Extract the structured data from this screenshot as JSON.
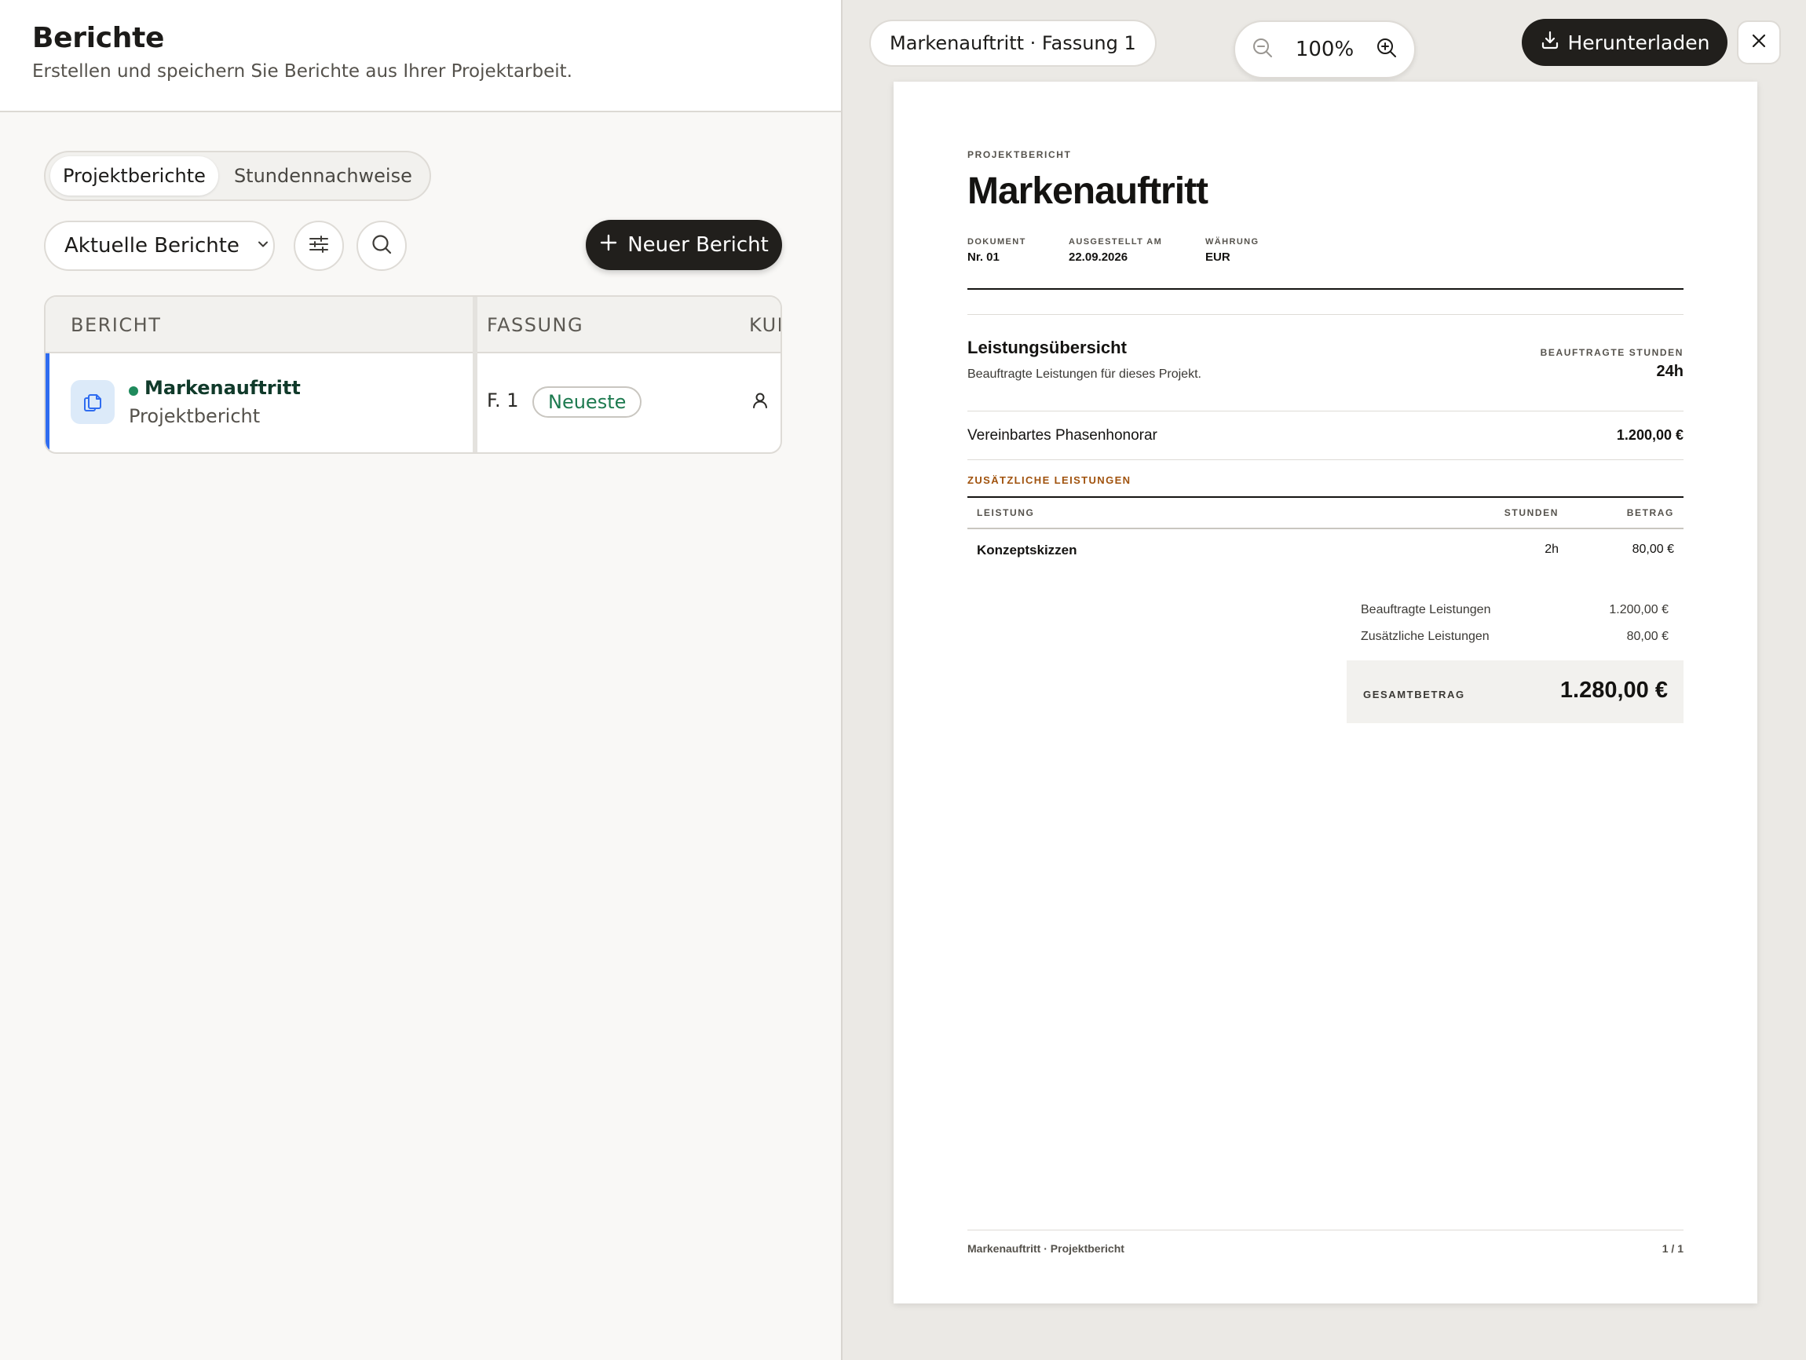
{
  "header": {
    "title": "Berichte",
    "subtitle": "Erstellen und speichern Sie Berichte aus Ihrer Projektarbeit."
  },
  "tabs": [
    {
      "label": "Projektberichte",
      "active": true
    },
    {
      "label": "Stundennachweise",
      "active": false
    }
  ],
  "toolbar": {
    "filter_value": "Aktuelle Berichte",
    "new_report_label": "Neuer Bericht"
  },
  "table": {
    "columns": [
      "BERICHT",
      "FASSUNG",
      "KUN"
    ],
    "rows": [
      {
        "title": "Markenauftritt",
        "subtitle": "Projektbericht",
        "version": "F. 1",
        "badge": "Neueste"
      }
    ]
  },
  "preview": {
    "doc_chip": "Markenauftritt · Fassung 1",
    "zoom_level": "100%",
    "download_label": "Herunterladen"
  },
  "document": {
    "kicker": "PROJEKTBERICHT",
    "title": "Markenauftritt",
    "meta": [
      {
        "label": "DOKUMENT",
        "value": "Nr. 01"
      },
      {
        "label": "AUSGESTELLT AM",
        "value": "22.09.2026"
      },
      {
        "label": "WÄHRUNG",
        "value": "EUR"
      }
    ],
    "section_title": "Leistungsübersicht",
    "section_sub": "Beauftragte Leistungen für dieses Projekt.",
    "hours_label": "BEAUFTRAGTE STUNDEN",
    "hours_value": "24h",
    "fee_label": "Vereinbartes Phasenhonorar",
    "fee_value": "1.200,00 €",
    "additional_heading": "ZUSÄTZLICHE LEISTUNGEN",
    "add_table": {
      "headers": [
        "LEISTUNG",
        "STUNDEN",
        "BETRAG"
      ],
      "rows": [
        {
          "service": "Konzeptskizzen",
          "hours": "2h",
          "amount": "80,00 €"
        }
      ]
    },
    "summary": [
      {
        "label": "Beauftragte Leistungen",
        "value": "1.200,00 €"
      },
      {
        "label": "Zusätzliche Leistungen",
        "value": "80,00 €"
      }
    ],
    "total_label": "GESAMTBETRAG",
    "total_value": "1.280,00 €",
    "footer_left": "Markenauftritt · Projektbericht",
    "footer_right": "1 / 1"
  },
  "icons": {
    "filter_chevron": "chevron-down-icon",
    "sliders": "sliders-icon",
    "search": "search-icon",
    "plus": "plus-icon",
    "row_icon": "document-copy-icon",
    "person": "person-icon",
    "zoom_out": "zoom-out-icon",
    "zoom_in": "zoom-in-icon",
    "download": "download-icon",
    "close": "close-icon"
  },
  "colors": {
    "accent_dark": "#211f1c",
    "row_accent": "#2f6cf0",
    "status_green": "#1d7a4f",
    "section_accent": "#a0520d"
  }
}
